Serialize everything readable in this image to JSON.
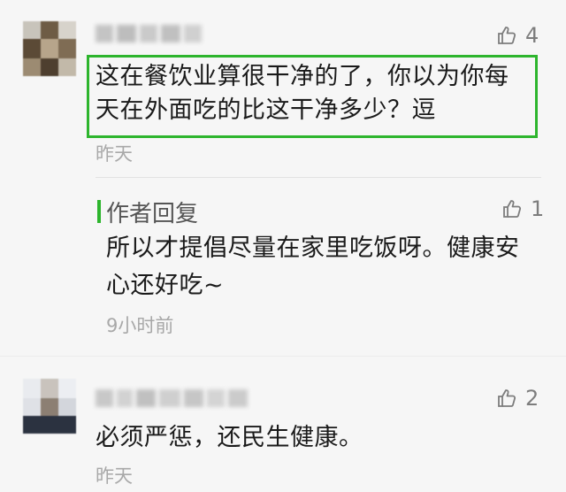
{
  "comments": [
    {
      "likes": "4",
      "text_line1": "这在餐饮业算很干净的了，你以为你每",
      "text_line2": "天在外面吃的比这干净多少？逗",
      "time": "昨天"
    },
    {
      "likes": "2",
      "text": "必须严惩，还民生健康。",
      "time": "昨天"
    }
  ],
  "reply": {
    "title": "作者回复",
    "likes": "1",
    "text_line1": "所以才提倡尽量在家里吃饭呀。健康安",
    "text_line2": "心还好吃~",
    "time": "9小时前"
  },
  "colors": {
    "accent": "#2db52d",
    "background": "#f6f6f6",
    "muted": "#a8a8a8"
  },
  "icons": {
    "like": "thumbs-up-icon"
  }
}
